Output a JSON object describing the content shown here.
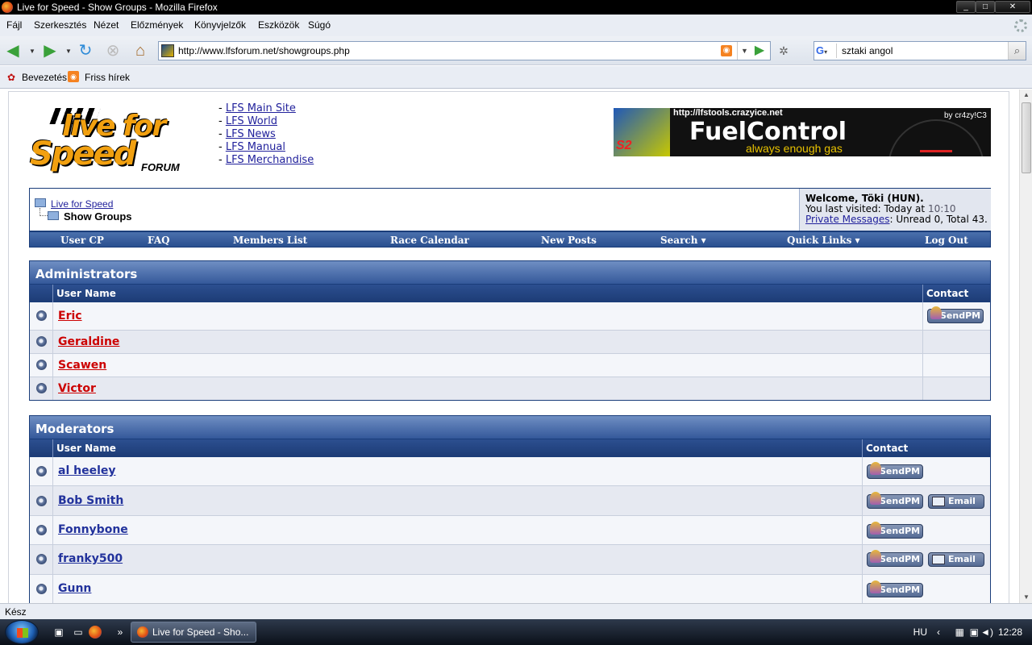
{
  "window": {
    "title": "Live for Speed - Show Groups - Mozilla Firefox",
    "min": "_",
    "max": "□",
    "close": "✕"
  },
  "menu": {
    "file": "Fájl",
    "edit": "Szerkesztés",
    "view": "Nézet",
    "history": "Előzmények",
    "bookmarks": "Könyvjelzők",
    "tools": "Eszközök",
    "help": "Súgó"
  },
  "nav": {
    "url": "http://www.lfsforum.net/showgroups.php",
    "search_value": "sztaki angol",
    "search_engine": "G"
  },
  "bookmarks_bar": {
    "item1": "Bevezetés",
    "item2": "Friss hírek"
  },
  "logo": {
    "line1": "live for",
    "line2": "Speed",
    "line3": "FORUM"
  },
  "top_links": [
    "LFS Main Site",
    "LFS World",
    "LFS News",
    "LFS Manual",
    "LFS Merchandise"
  ],
  "banner": {
    "url": "http://lfstools.crazyice.net",
    "by": "by cr4zy!C3",
    "title": "FuelControl",
    "tagline": "always enough gas",
    "s2": "S2"
  },
  "breadcrumb": {
    "root": "Live for Speed",
    "current": "Show Groups"
  },
  "userbox": {
    "welcome": "Welcome, Töki (HUN).",
    "last_visit_label": "You last visited: Today at",
    "last_visit_time": "10:10",
    "pm_link": "Private Messages",
    "pm_info": ": Unread 0, Total 43."
  },
  "navmenu": {
    "usercp": "User CP",
    "faq": "FAQ",
    "members": "Members List",
    "race": "Race Calendar",
    "newposts": "New Posts",
    "search": "Search ▾",
    "quicklinks": "Quick Links ▾",
    "logout": "Log Out"
  },
  "groups": {
    "admins": {
      "title": "Administrators",
      "col_user": "User Name",
      "col_contact": "Contact",
      "rows": [
        {
          "name": "Eric",
          "pm": "SendPM"
        },
        {
          "name": "Geraldine"
        },
        {
          "name": "Scawen"
        },
        {
          "name": "Victor"
        }
      ]
    },
    "mods": {
      "title": "Moderators",
      "col_user": "User Name",
      "col_contact": "Contact",
      "rows": [
        {
          "name": "al heeley",
          "pm": "SendPM"
        },
        {
          "name": "Bob Smith",
          "pm": "SendPM",
          "email": "Email"
        },
        {
          "name": "Fonnybone",
          "pm": "SendPM"
        },
        {
          "name": "franky500",
          "pm": "SendPM",
          "email": "Email"
        },
        {
          "name": "Gunn",
          "pm": "SendPM"
        }
      ]
    }
  },
  "status": "Kész",
  "taskbar": {
    "task": "Live for Speed - Sho...",
    "lang": "HU",
    "clock": "12:28",
    "chevron": "»"
  }
}
